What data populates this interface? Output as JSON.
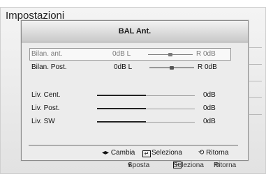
{
  "background": {
    "title": "Impostazioni",
    "footer": {
      "move_label": "Sposta",
      "select_label": "Seleziona",
      "return_label": "Ritorna"
    }
  },
  "dialog": {
    "title": "BAL Ant.",
    "balance_rows": [
      {
        "label": "Bilan. ant.",
        "left_value": "0dB L",
        "right_value": "R 0dB",
        "balance": 0.5,
        "selected": true
      },
      {
        "label": "Bilan. Post.",
        "left_value": "0dB L",
        "right_value": "R 0dB",
        "balance": 0.5,
        "selected": false
      }
    ],
    "level_rows": [
      {
        "label": "Liv. Cent.",
        "value": "0dB",
        "level_fraction": 0.5
      },
      {
        "label": "Liv. Post.",
        "value": "0dB",
        "level_fraction": 0.5
      },
      {
        "label": "Liv. SW",
        "value": "0dB",
        "level_fraction": 0.5
      }
    ],
    "footer": {
      "change_icon": "left-right-arrows-icon",
      "change_label": "Cambia",
      "select_icon": "enter-icon",
      "select_label": "Seleziona",
      "return_icon": "return-arrow-icon",
      "return_label": "Ritorna"
    }
  }
}
